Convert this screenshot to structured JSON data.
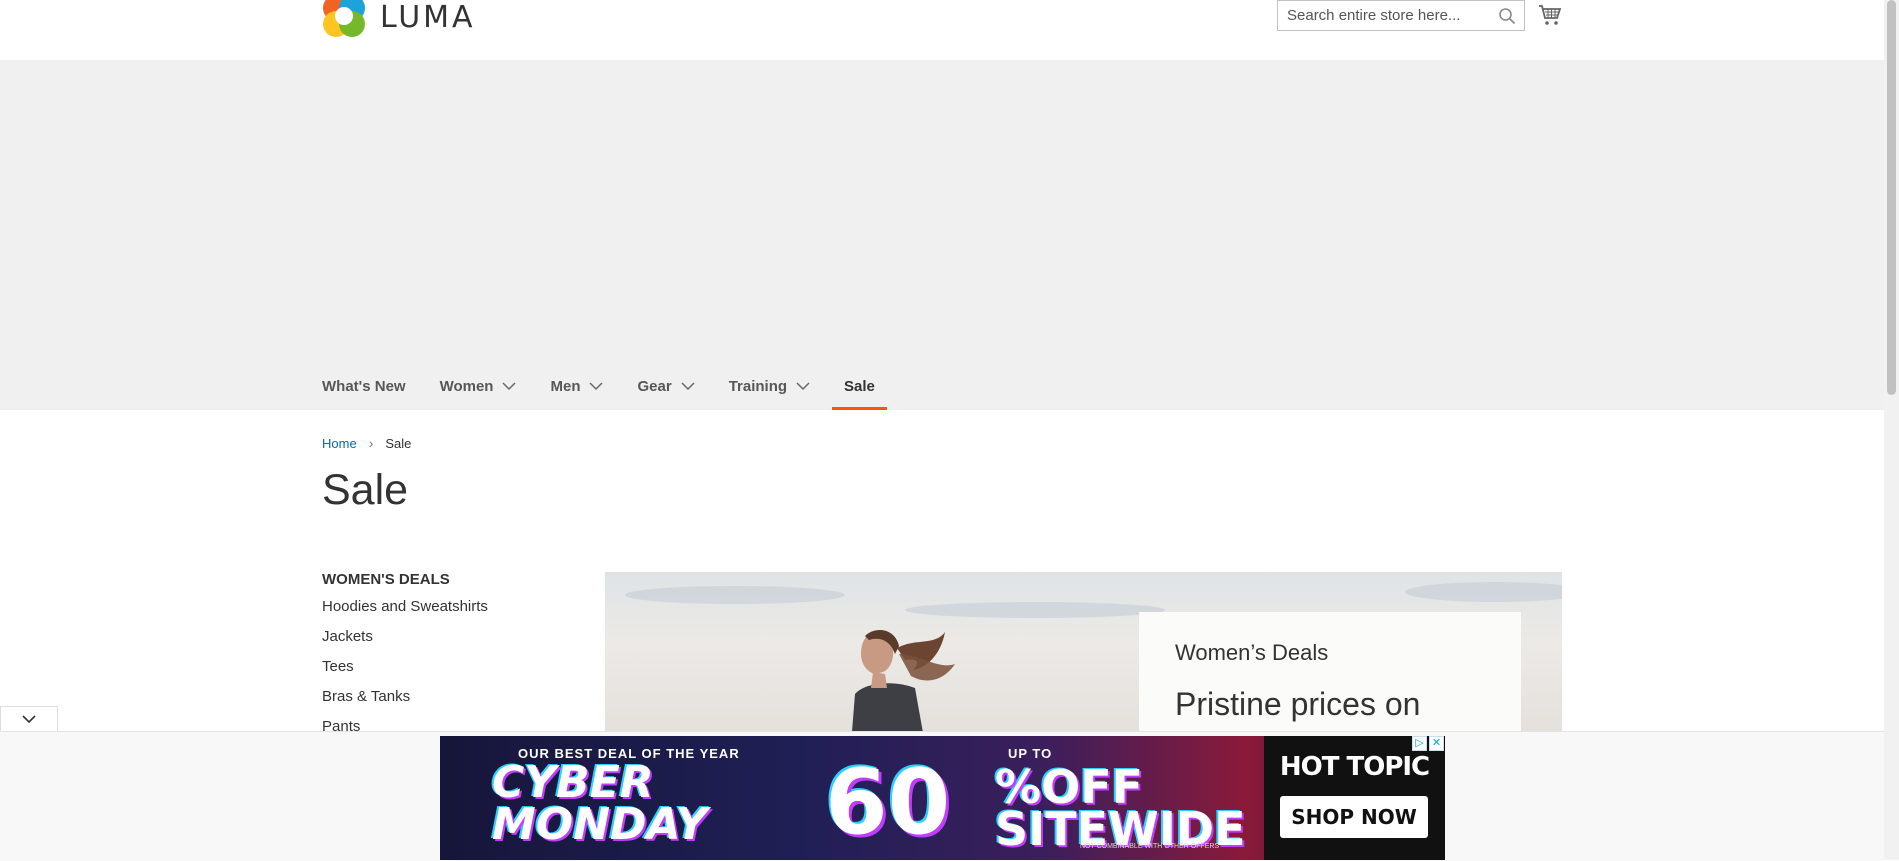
{
  "header": {
    "logo_text": "LUMA",
    "search_placeholder": "Search entire store here..."
  },
  "nav": {
    "items": [
      {
        "label": "What's New",
        "has_dropdown": false
      },
      {
        "label": "Women",
        "has_dropdown": true
      },
      {
        "label": "Men",
        "has_dropdown": true
      },
      {
        "label": "Gear",
        "has_dropdown": true
      },
      {
        "label": "Training",
        "has_dropdown": true
      },
      {
        "label": "Sale",
        "has_dropdown": false,
        "active": true
      }
    ],
    "active_color": "#ff5501"
  },
  "breadcrumb": {
    "home": "Home",
    "current": "Sale"
  },
  "page_title": "Sale",
  "sidebar": {
    "heading": "WOMEN'S DEALS",
    "links": [
      "Hoodies and Sweatshirts",
      "Jackets",
      "Tees",
      "Bras & Tanks",
      "Pants"
    ]
  },
  "promo": {
    "subtitle": "Women’s Deals",
    "headline": "Pristine prices on"
  },
  "ad": {
    "tagline": "OUR BEST DEAL OF THE YEAR",
    "cyber": "CYBER",
    "monday": "MONDAY",
    "up_to": "UP TO",
    "percent": "60",
    "off": "%OFF",
    "sitewide": "SITEWIDE",
    "fineprint": "NOT COMBINABLE WITH OTHER OFFERS",
    "brand": "HOT TOPIC",
    "cta": "SHOP NOW"
  },
  "colors": {
    "link": "#006bb4",
    "hero_bg": "#f0f0f0",
    "text": "#333333"
  },
  "icons": [
    "luma-logo-icon",
    "search-icon",
    "cart-icon",
    "chevron-down-icon",
    "chevron-right-icon",
    "ad-choices-icon",
    "close-icon"
  ]
}
